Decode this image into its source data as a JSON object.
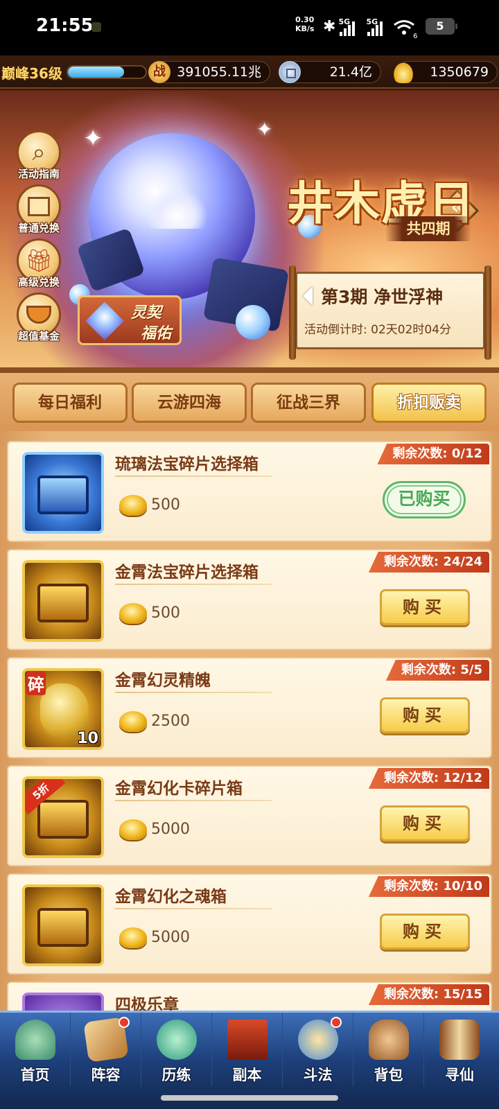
{
  "status_bar": {
    "time": "21:55",
    "net_speed": "0.30",
    "net_unit": "KB/s",
    "sim1": "5G",
    "sim2": "5G",
    "wifi": "6",
    "battery": "5"
  },
  "player": {
    "level": "巅峰36级",
    "exp_progress": 0.72,
    "power_label": "战",
    "power": "391055.11兆",
    "coins": "21.4亿",
    "ingots": "1350679"
  },
  "banner": {
    "title": "井木虚日",
    "subtitle": "共四期",
    "period": "第3期  净世浮神",
    "countdown": "活动倒计时: 02天02时04分",
    "promo_line1": "灵契",
    "promo_line2": "福佑",
    "side_buttons": [
      {
        "label": "活动指南",
        "icon": "magnifier-icon"
      },
      {
        "label": "普通兑换",
        "icon": "box-icon"
      },
      {
        "label": "高级兑换",
        "icon": "gift-icon"
      },
      {
        "label": "超值基金",
        "icon": "fund-pot-icon"
      }
    ]
  },
  "tabs": [
    {
      "label": "每日福利",
      "active": false
    },
    {
      "label": "云游四海",
      "active": false
    },
    {
      "label": "征战三界",
      "active": false
    },
    {
      "label": "折扣贩卖",
      "active": true
    }
  ],
  "items": [
    {
      "name": "琉璃法宝碎片选择箱",
      "price": "500",
      "remaining": "剩余次数: 0/12",
      "button": "已购买",
      "bought": true,
      "qty": "",
      "fragment": "",
      "discount": ""
    },
    {
      "name": "金霄法宝碎片选择箱",
      "price": "500",
      "remaining": "剩余次数: 24/24",
      "button": "购买",
      "bought": false,
      "qty": "",
      "fragment": "",
      "discount": ""
    },
    {
      "name": "金霄幻灵精魄",
      "price": "2500",
      "remaining": "剩余次数: 5/5",
      "button": "购买",
      "bought": false,
      "qty": "10",
      "fragment": "碎",
      "discount": ""
    },
    {
      "name": "金霄幻化卡碎片箱",
      "price": "5000",
      "remaining": "剩余次数: 12/12",
      "button": "购买",
      "bought": false,
      "qty": "",
      "fragment": "",
      "discount": "5折"
    },
    {
      "name": "金霄幻化之魂箱",
      "price": "5000",
      "remaining": "剩余次数: 10/10",
      "button": "购买",
      "bought": false,
      "qty": "",
      "fragment": "",
      "discount": ""
    },
    {
      "name": "四极乐章",
      "price": "",
      "remaining": "剩余次数: 15/15",
      "button": "",
      "bought": false,
      "qty": "",
      "fragment": "",
      "discount": ""
    }
  ],
  "nav": [
    {
      "label": "首页",
      "dot": false
    },
    {
      "label": "阵容",
      "dot": true
    },
    {
      "label": "历练",
      "dot": false
    },
    {
      "label": "副本",
      "dot": false
    },
    {
      "label": "斗法",
      "dot": true
    },
    {
      "label": "背包",
      "dot": false
    },
    {
      "label": "寻仙",
      "dot": false
    }
  ],
  "colors": {
    "accent_gold": "#f6cc4a",
    "bought_green": "#5cb86a",
    "remain_red": "#d8301a",
    "nav_blue": "#1d3f7a"
  }
}
